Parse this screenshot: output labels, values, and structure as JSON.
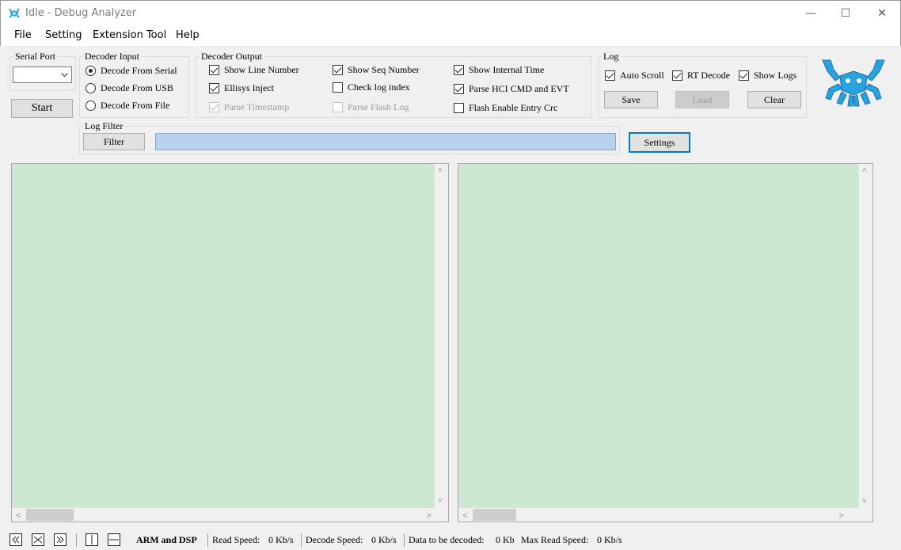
{
  "window": {
    "title": "Idle - Debug Analyzer",
    "controls": {
      "minimize": "—",
      "maximize": "☐",
      "close": "✕"
    }
  },
  "menu": [
    "File",
    "Setting",
    "Extension Tool",
    "Help"
  ],
  "serial_port": {
    "label": "Serial Port",
    "value": "",
    "start_label": "Start"
  },
  "decoder_input": {
    "label": "Decoder Input",
    "options": [
      "Decode From Serial",
      "Decode From USB",
      "Decode From File"
    ],
    "selected": "Decode From Serial"
  },
  "decoder_output": {
    "label": "Decoder Output",
    "options": [
      {
        "label": "Show Line Number",
        "checked": true,
        "enabled": true
      },
      {
        "label": "Ellisys Inject",
        "checked": true,
        "enabled": true
      },
      {
        "label": "Parse Timestamp",
        "checked": true,
        "enabled": false
      },
      {
        "label": "Show Seq Number",
        "checked": true,
        "enabled": true
      },
      {
        "label": "Check log index",
        "checked": false,
        "enabled": true
      },
      {
        "label": "Parse Flash Log",
        "checked": false,
        "enabled": false
      },
      {
        "label": "Show Internal Time",
        "checked": true,
        "enabled": true
      },
      {
        "label": "Parse HCI CMD and EVT",
        "checked": true,
        "enabled": true
      },
      {
        "label": "Flash Enable Entry Crc",
        "checked": false,
        "enabled": true
      }
    ]
  },
  "log": {
    "label": "Log",
    "options": [
      {
        "label": "Auto Scroll",
        "checked": true
      },
      {
        "label": "RT Decode",
        "checked": true
      },
      {
        "label": "Show Logs",
        "checked": true
      }
    ],
    "buttons": {
      "save": "Save",
      "load": "Load",
      "clear": "Clear"
    }
  },
  "log_filter": {
    "label": "Log Filter",
    "filter_button": "Filter",
    "value": "",
    "settings_button": "Settings"
  },
  "status": {
    "mode": "ARM and DSP",
    "read_speed_label": "Read Speed:",
    "read_speed": "0 Kb/s",
    "decode_speed_label": "Decode Speed:",
    "decode_speed": "0 Kb/s",
    "data_to_decode_label": "Data to be decoded:",
    "data_to_decode": "0 Kb",
    "max_read_speed_label": "Max Read Speed:",
    "max_read_speed": "0 Kb/s"
  },
  "colors": {
    "pane_bg": "#cde8d0",
    "filter_input_bg": "#b8d1ec",
    "logo": "#29a3e0",
    "focus": "#0078d7"
  },
  "icons": [
    "app-logo-icon",
    "crab-logo-icon",
    "first-icon",
    "stop-icon",
    "last-icon",
    "split-vertical-icon",
    "split-horizontal-icon"
  ]
}
